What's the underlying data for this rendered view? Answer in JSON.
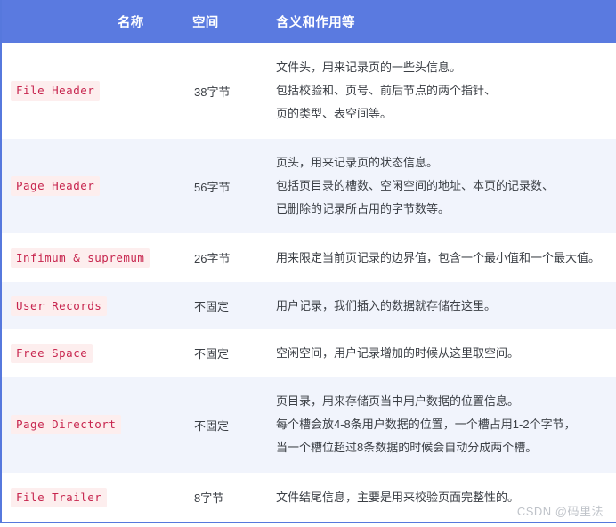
{
  "table": {
    "columns": [
      {
        "key": "name",
        "label": "名称"
      },
      {
        "key": "space",
        "label": "空间"
      },
      {
        "key": "desc",
        "label": "含义和作用等"
      }
    ],
    "header_bg": "#5a7ae0",
    "header_text_color": "#ffffff",
    "stripe_bg": "#f1f4fc",
    "row_bg": "#ffffff",
    "border_color": "#5678dd",
    "code_text_color": "#c7254e",
    "code_bg_color": "#fdeeee",
    "rows": [
      {
        "name": "File Header",
        "space": "38字节",
        "desc_lines": [
          "文件头，用来记录页的一些头信息。",
          "包括校验和、页号、前后节点的两个指针、",
          "页的类型、表空间等。"
        ]
      },
      {
        "name": "Page Header",
        "space": "56字节",
        "desc_lines": [
          "页头，用来记录页的状态信息。",
          "包括页目录的槽数、空闲空间的地址、本页的记录数、",
          "已删除的记录所占用的字节数等。"
        ]
      },
      {
        "name": "Infimum & supremum",
        "space": "26字节",
        "desc_lines": [
          "用来限定当前页记录的边界值，包含一个最小值和一个最大值。"
        ]
      },
      {
        "name": "User Records",
        "space": "不固定",
        "desc_lines": [
          "用户记录，我们插入的数据就存储在这里。"
        ]
      },
      {
        "name": "Free Space",
        "space": "不固定",
        "desc_lines": [
          "空闲空间，用户记录增加的时候从这里取空间。"
        ]
      },
      {
        "name": "Page Directort",
        "space": "不固定",
        "desc_lines": [
          "页目录，用来存储页当中用户数据的位置信息。",
          "每个槽会放4-8条用户数据的位置，一个槽占用1-2个字节，",
          "当一个槽位超过8条数据的时候会自动分成两个槽。"
        ]
      },
      {
        "name": "File Trailer",
        "space": "8字节",
        "desc_lines": [
          "文件结尾信息，主要是用来校验页面完整性的。"
        ]
      }
    ]
  },
  "watermark": {
    "text": "CSDN @码里法"
  }
}
